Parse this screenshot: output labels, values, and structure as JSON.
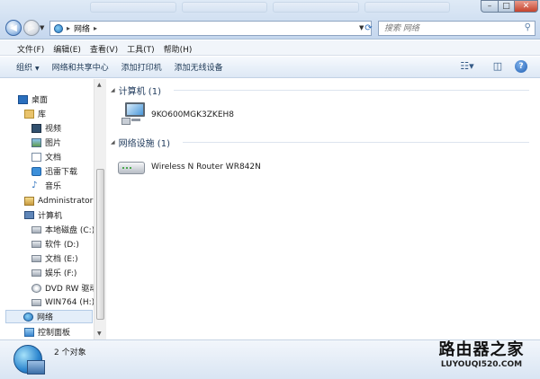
{
  "window": {
    "controls": {
      "minimize": "–",
      "maximize": "□",
      "close": "✕"
    }
  },
  "address_bar": {
    "crumbs": [
      "网络"
    ],
    "search_placeholder": "搜索 网络"
  },
  "menu": [
    "文件(F)",
    "编辑(E)",
    "查看(V)",
    "工具(T)",
    "帮助(H)"
  ],
  "commands": {
    "organize": "组织",
    "network_center": "网络和共享中心",
    "add_printer": "添加打印机",
    "add_wireless": "添加无线设备"
  },
  "nav": {
    "desktop": "桌面",
    "library": "库",
    "videos": "视频",
    "pictures": "图片",
    "documents": "文档",
    "thunder_downloads": "迅雷下载",
    "music": "音乐",
    "administrator": "Administrator",
    "computer": "计算机",
    "drive_c": "本地磁盘 (C:)",
    "drive_d": "软件 (D:)",
    "drive_e": "文档 (E:)",
    "drive_f": "娱乐 (F:)",
    "drive_dvd": "DVD RW 驱动",
    "drive_h": "WIN764 (H:)",
    "network": "网络",
    "control_panel": "控制面板"
  },
  "content": {
    "group_computers": "计算机 (1)",
    "computer_name": "9KO600MGK3ZKEH8",
    "group_devices": "网络设施 (1)",
    "router_name": "Wireless N Router WR842N"
  },
  "details": {
    "count": "2 个对象"
  },
  "watermark": {
    "cn": "路由器之家",
    "en": "LUYOUQI520.COM"
  },
  "icons": [
    "back-arrow-icon",
    "forward-arrow-icon",
    "network-icon",
    "refresh-icon",
    "search-icon",
    "view-icon",
    "preview-pane-icon",
    "help-icon",
    "desktop-icon",
    "library-icon",
    "video-icon",
    "picture-icon",
    "document-icon",
    "download-icon",
    "music-icon",
    "user-icon",
    "computer-icon",
    "drive-icon",
    "dvd-icon",
    "control-panel-icon",
    "router-icon"
  ]
}
